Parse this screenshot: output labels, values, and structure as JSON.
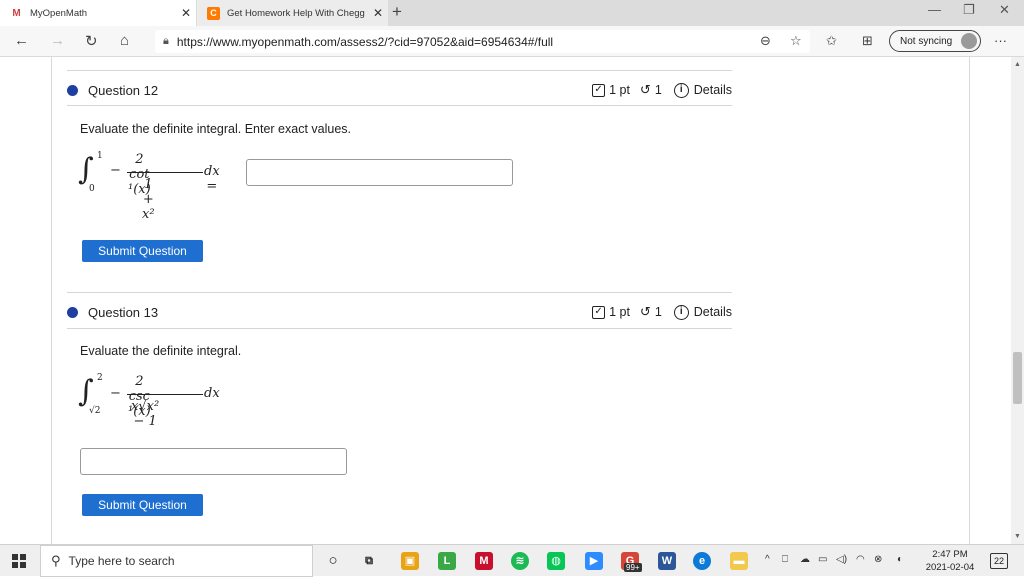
{
  "browser": {
    "tabs": [
      {
        "label": "MyOpenMath",
        "favicon": "M"
      },
      {
        "label": "Get Homework Help With Chegg",
        "favicon": "C"
      }
    ],
    "url": "https://www.myopenmath.com/assess2/?cid=97052&aid=6954634#/full",
    "sync_label": "Not syncing",
    "new_tab": "+",
    "more": "···"
  },
  "questions": [
    {
      "title": "Question 12",
      "points": "1 pt",
      "retries": "1",
      "details": "Details",
      "prompt": "Evaluate the definite integral. Enter exact values.",
      "math": {
        "upper": "1",
        "lower": "0",
        "numerator": "2 cot  ¹(x)",
        "denominator": "1 + x²",
        "tail": "dx ="
      },
      "submit_label": "Submit Question"
    },
    {
      "title": "Question 13",
      "points": "1 pt",
      "retries": "1",
      "details": "Details",
      "prompt": "Evaluate the definite integral.",
      "math": {
        "upper": "2",
        "lower": "√2",
        "numerator": "2 csc  ¹(x)",
        "denominator": "x√x² − 1",
        "tail": "dx"
      },
      "submit_label": "Submit Question"
    }
  ],
  "taskbar": {
    "search_placeholder": "Type here to search",
    "time": "2:47 PM",
    "date": "2021-02-04",
    "notifications": "22",
    "mail_badge": "99+"
  },
  "colors": {
    "accent": "#1e6fd0",
    "bullet": "#1f3fa0"
  }
}
